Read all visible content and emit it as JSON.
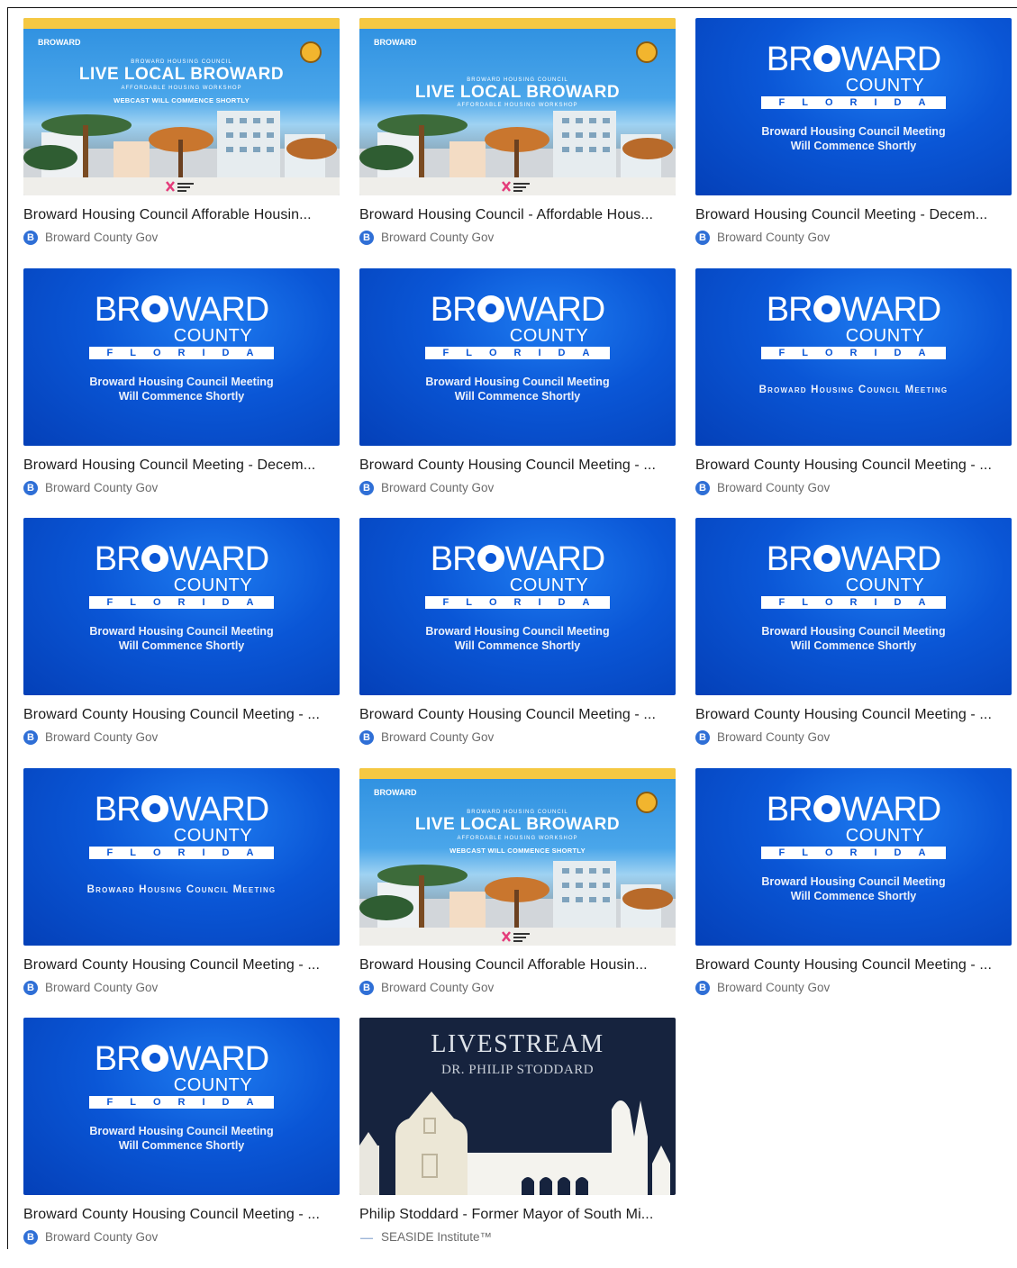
{
  "videos": [
    {
      "thumb": "live",
      "title": "Broward Housing Council Afforable Housin...",
      "channel": "Broward County Gov",
      "channel_icon": "B",
      "webcast": true
    },
    {
      "thumb": "live",
      "title": "Broward Housing Council - Affordable Hous...",
      "channel": "Broward County Gov",
      "channel_icon": "B",
      "webcast": false
    },
    {
      "thumb": "blue",
      "title": "Broward Housing Council Meeting - Decem...",
      "channel": "Broward County Gov",
      "channel_icon": "B",
      "caps": false
    },
    {
      "thumb": "blue",
      "title": "Broward Housing Council Meeting - Decem...",
      "channel": "Broward County Gov",
      "channel_icon": "B",
      "caps": false
    },
    {
      "thumb": "blue",
      "title": "Broward County Housing Council Meeting - ...",
      "channel": "Broward County Gov",
      "channel_icon": "B",
      "caps": false
    },
    {
      "thumb": "blue",
      "title": "Broward County Housing Council Meeting - ...",
      "channel": "Broward County Gov",
      "channel_icon": "B",
      "caps": true
    },
    {
      "thumb": "blue",
      "title": "Broward County Housing Council Meeting - ...",
      "channel": "Broward County Gov",
      "channel_icon": "B",
      "caps": false
    },
    {
      "thumb": "blue",
      "title": "Broward County Housing Council Meeting - ...",
      "channel": "Broward County Gov",
      "channel_icon": "B",
      "caps": false
    },
    {
      "thumb": "blue",
      "title": "Broward County Housing Council Meeting - ...",
      "channel": "Broward County Gov",
      "channel_icon": "B",
      "caps": false
    },
    {
      "thumb": "blue",
      "title": "Broward County Housing Council Meeting - ...",
      "channel": "Broward County Gov",
      "channel_icon": "B",
      "caps": true
    },
    {
      "thumb": "live",
      "title": "Broward Housing Council Afforable Housin...",
      "channel": "Broward County Gov",
      "channel_icon": "B",
      "webcast": true
    },
    {
      "thumb": "blue",
      "title": "Broward County Housing Council Meeting - ...",
      "channel": "Broward County Gov",
      "channel_icon": "B",
      "caps": false
    },
    {
      "thumb": "blue",
      "title": "Broward County Housing Council Meeting - ...",
      "channel": "Broward County Gov",
      "channel_icon": "B",
      "caps": false
    },
    {
      "thumb": "stream",
      "title": "Philip Stoddard - Former Mayor of South Mi...",
      "channel": "SEASIDE Institute™",
      "channel_icon": "—"
    }
  ],
  "thumb_text": {
    "broward_word_a": "BR",
    "broward_word_b": "WARD",
    "county": "COUNTY",
    "florida": "FLORIDA",
    "meeting_line1": "Broward Housing Council Meeting",
    "meeting_line2": "Will Commence Shortly",
    "meeting_caps": "Broward Housing Council Meeting",
    "live_brand": "BROWARD",
    "live_council": "BROWARD HOUSING COUNCIL",
    "live_title": "LIVE LOCAL BROWARD",
    "live_workshop": "AFFORDABLE HOUSING WORKSHOP",
    "live_webcast": "WEBCAST WILL COMMENCE SHORTLY",
    "stream_title": "LIVESTREAM",
    "stream_sub": "DR. PHILIP STODDARD"
  },
  "colors": {
    "broward_blue": "#0a56d6",
    "live_banner": "#f5c842",
    "stream_bg": "#16233e",
    "channel_icon": "#2f6fd6"
  }
}
